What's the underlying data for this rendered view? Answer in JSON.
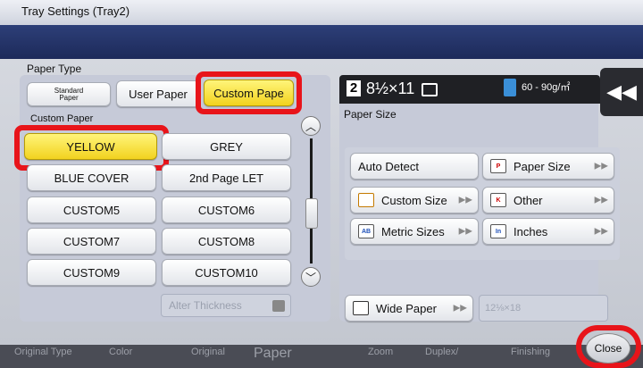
{
  "window": {
    "title": "Tray Settings (Tray2)"
  },
  "paper_type": {
    "label": "Paper Type",
    "tabs": [
      {
        "label": "Standard Paper"
      },
      {
        "label": "User Paper"
      },
      {
        "label": "Custom Pape",
        "selected": true
      }
    ],
    "section_label": "Custom Paper",
    "buttons": [
      {
        "label": "YELLOW",
        "selected": true
      },
      {
        "label": "GREY"
      },
      {
        "label": "BLUE COVER"
      },
      {
        "label": "2nd Page LET"
      },
      {
        "label": "CUSTOM5"
      },
      {
        "label": "CUSTOM6"
      },
      {
        "label": "CUSTOM7"
      },
      {
        "label": "CUSTOM8"
      },
      {
        "label": "CUSTOM9"
      },
      {
        "label": "CUSTOM10"
      }
    ],
    "alter_thickness": "Alter Thickness",
    "scroll_up": "︿",
    "scroll_down": "﹀"
  },
  "info": {
    "tray_number": "2",
    "size": "8½×11",
    "weight": "60 - 90g/㎡",
    "rewind_glyph": "◀◀"
  },
  "paper_size": {
    "label": "Paper Size",
    "buttons": [
      {
        "label": "Auto Detect"
      },
      {
        "label": "Paper Size",
        "icon": "paper-size-icon"
      },
      {
        "label": "Custom Size",
        "icon": "custom-size-icon"
      },
      {
        "label": "Other",
        "icon": "other-icon"
      },
      {
        "label": "Metric Sizes",
        "icon": "metric-sizes-icon"
      },
      {
        "label": "Inches",
        "icon": "inches-icon"
      }
    ],
    "wide_paper": "Wide Paper",
    "wide_value": "12⅛×18"
  },
  "bottom_tabs": [
    {
      "label": "Original Type"
    },
    {
      "label": "Color"
    },
    {
      "label": "Original"
    },
    {
      "label": "Paper"
    },
    {
      "label": "Zoom"
    },
    {
      "label": "Duplex/"
    },
    {
      "label": "Finishing"
    }
  ],
  "close_button": "Close",
  "colors": {
    "highlight": "#e8141a",
    "selected_fill": "#f2d21f",
    "title_band": "#1d2a5a"
  }
}
